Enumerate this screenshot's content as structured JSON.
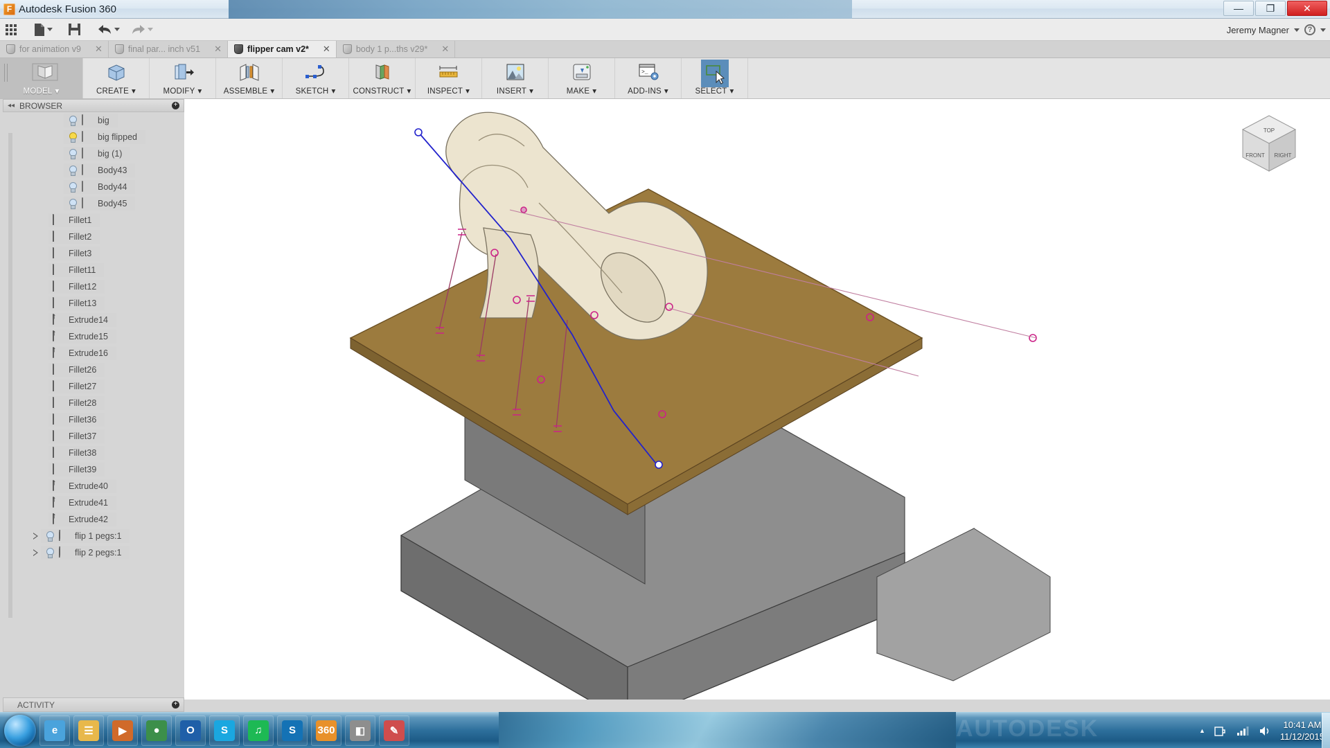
{
  "window": {
    "title": "Autodesk Fusion 360",
    "app_icon": "fusion-360-icon",
    "buttons": {
      "minimize": "—",
      "maximize": "❐",
      "close": "✕"
    }
  },
  "quick_access": {
    "items": [
      {
        "name": "app-grid-button",
        "icon": "grid-icon",
        "caret": false
      },
      {
        "name": "new-document-button",
        "icon": "file-icon",
        "caret": true
      },
      {
        "name": "save-button",
        "icon": "save-disk-icon",
        "caret": false
      },
      {
        "name": "undo-button",
        "icon": "undo-arrow-icon",
        "caret": true
      },
      {
        "name": "redo-button",
        "icon": "redo-arrow-icon",
        "caret": true
      }
    ],
    "user_name": "Jeremy Magner",
    "help_label": "?"
  },
  "document_tabs": [
    {
      "label": "for animation v9",
      "active": false,
      "close": "✕"
    },
    {
      "label": "final par... inch v51",
      "active": false,
      "close": "✕"
    },
    {
      "label": "flipper cam v2*",
      "active": true,
      "close": "✕"
    },
    {
      "label": "body 1 p...ths v29*",
      "active": false,
      "close": "✕"
    }
  ],
  "ribbon": {
    "workspace": {
      "label": "MODEL",
      "caret": "▾",
      "icon": "model-workspace-icon"
    },
    "items": [
      {
        "label": "CREATE",
        "caret": "▾",
        "icon": "create-cube-icon",
        "selected": false
      },
      {
        "label": "MODIFY",
        "caret": "▾",
        "icon": "modify-press-pull-icon",
        "selected": false
      },
      {
        "label": "ASSEMBLE",
        "caret": "▾",
        "icon": "assemble-joint-icon",
        "selected": false
      },
      {
        "label": "SKETCH",
        "caret": "▾",
        "icon": "sketch-spline-icon",
        "selected": false
      },
      {
        "label": "CONSTRUCT",
        "caret": "▾",
        "icon": "construct-plane-icon",
        "selected": false
      },
      {
        "label": "INSPECT",
        "caret": "▾",
        "icon": "inspect-ruler-icon",
        "selected": false
      },
      {
        "label": "INSERT",
        "caret": "▾",
        "icon": "insert-image-icon",
        "selected": false
      },
      {
        "label": "MAKE",
        "caret": "▾",
        "icon": "make-3d-print-icon",
        "selected": false
      },
      {
        "label": "ADD-INS",
        "caret": "▾",
        "icon": "add-ins-script-icon",
        "selected": false
      },
      {
        "label": "SELECT",
        "caret": "▾",
        "icon": "select-cursor-icon",
        "selected": true
      }
    ]
  },
  "browser": {
    "title": "BROWSER",
    "collapse_icon": "◂◂",
    "options_icon": "⊕",
    "nodes": [
      {
        "label": "big",
        "type": "body",
        "bulb": "off",
        "indent": 3,
        "expand": false
      },
      {
        "label": "big flipped",
        "type": "body",
        "bulb": "on",
        "indent": 3,
        "expand": false
      },
      {
        "label": "big (1)",
        "type": "body",
        "bulb": "off",
        "indent": 3,
        "expand": false
      },
      {
        "label": "Body43",
        "type": "body",
        "bulb": "off",
        "indent": 3,
        "expand": false
      },
      {
        "label": "Body44",
        "type": "body",
        "bulb": "off",
        "indent": 3,
        "expand": false
      },
      {
        "label": "Body45",
        "type": "body",
        "bulb": "off",
        "indent": 3,
        "expand": false
      },
      {
        "label": "Fillet1",
        "type": "fillet",
        "bulb": "none",
        "indent": 2,
        "expand": false
      },
      {
        "label": "Fillet2",
        "type": "fillet",
        "bulb": "none",
        "indent": 2,
        "expand": false
      },
      {
        "label": "Fillet3",
        "type": "fillet",
        "bulb": "none",
        "indent": 2,
        "expand": false
      },
      {
        "label": "Fillet11",
        "type": "fillet",
        "bulb": "none",
        "indent": 2,
        "expand": false
      },
      {
        "label": "Fillet12",
        "type": "fillet",
        "bulb": "none",
        "indent": 2,
        "expand": false
      },
      {
        "label": "Fillet13",
        "type": "fillet",
        "bulb": "none",
        "indent": 2,
        "expand": false
      },
      {
        "label": "Extrude14",
        "type": "extrude",
        "bulb": "none",
        "indent": 2,
        "expand": false
      },
      {
        "label": "Extrude15",
        "type": "extrude",
        "bulb": "none",
        "indent": 2,
        "expand": false
      },
      {
        "label": "Extrude16",
        "type": "extrude",
        "bulb": "none",
        "indent": 2,
        "expand": false
      },
      {
        "label": "Fillet26",
        "type": "fillet",
        "bulb": "none",
        "indent": 2,
        "expand": false
      },
      {
        "label": "Fillet27",
        "type": "fillet",
        "bulb": "none",
        "indent": 2,
        "expand": false
      },
      {
        "label": "Fillet28",
        "type": "fillet",
        "bulb": "none",
        "indent": 2,
        "expand": false
      },
      {
        "label": "Fillet36",
        "type": "fillet",
        "bulb": "none",
        "indent": 2,
        "expand": false
      },
      {
        "label": "Fillet37",
        "type": "fillet",
        "bulb": "none",
        "indent": 2,
        "expand": false
      },
      {
        "label": "Fillet38",
        "type": "fillet",
        "bulb": "none",
        "indent": 2,
        "expand": false
      },
      {
        "label": "Fillet39",
        "type": "fillet",
        "bulb": "none",
        "indent": 2,
        "expand": false
      },
      {
        "label": "Extrude40",
        "type": "extrude",
        "bulb": "none",
        "indent": 2,
        "expand": false
      },
      {
        "label": "Extrude41",
        "type": "extrude",
        "bulb": "none",
        "indent": 2,
        "expand": false
      },
      {
        "label": "Extrude42",
        "type": "extrude",
        "bulb": "none",
        "indent": 2,
        "expand": false
      },
      {
        "label": "flip 1 pegs:1",
        "type": "component",
        "bulb": "off",
        "indent": 1,
        "expand": true
      },
      {
        "label": "flip 2 pegs:1",
        "type": "component",
        "bulb": "off",
        "indent": 1,
        "expand": true
      }
    ]
  },
  "activity": {
    "title": "ACTIVITY",
    "options_icon": "⊕"
  },
  "canvas": {
    "viewcube": {
      "top": "TOP",
      "front": "FRONT",
      "right": "RIGHT"
    },
    "model_colors": {
      "plywood_top": "#9c7b3e",
      "metal_base": "#8e8e8e",
      "metal_base_dark": "#6e6e6e",
      "bone_part": "#ece4cf",
      "sketch_line": "#2222cc",
      "constraint_point": "#cc2288",
      "dimension_line": "#9b3a63"
    }
  },
  "navbar": {
    "group1": [
      {
        "name": "orbit-button",
        "icon": "orbit-icon",
        "caret": true
      },
      {
        "name": "look-at-button",
        "icon": "look-at-icon",
        "caret": false
      },
      {
        "name": "pan-button",
        "icon": "hand-pan-icon",
        "caret": false
      },
      {
        "name": "zoom-button",
        "icon": "zoom-icon",
        "caret": false
      },
      {
        "name": "fit-button",
        "icon": "fit-view-icon",
        "caret": false
      }
    ],
    "group2": [
      {
        "name": "display-settings-button",
        "icon": "monitor-icon",
        "caret": true
      },
      {
        "name": "grid-snap-button",
        "icon": "grid-snap-icon",
        "caret": true
      },
      {
        "name": "viewports-button",
        "icon": "viewports-icon",
        "caret": true
      }
    ]
  },
  "taskbar": {
    "start": "start-orb",
    "apps": [
      {
        "name": "internet-explorer-icon",
        "glyph": "e",
        "color": "#4aa3dc"
      },
      {
        "name": "file-explorer-icon",
        "glyph": "☰",
        "color": "#e8b84b"
      },
      {
        "name": "media-player-icon",
        "glyph": "▶",
        "color": "#d06a2a"
      },
      {
        "name": "google-chrome-icon",
        "glyph": "●",
        "color": "#3c8f4a"
      },
      {
        "name": "outlook-icon",
        "glyph": "O",
        "color": "#1f5fa8"
      },
      {
        "name": "skype-icon",
        "glyph": "S",
        "color": "#1aa7e0"
      },
      {
        "name": "spotify-icon",
        "glyph": "♫",
        "color": "#1db954"
      },
      {
        "name": "skype-business-icon",
        "glyph": "S",
        "color": "#1472b5"
      },
      {
        "name": "fusion-360-icon",
        "glyph": "360",
        "color": "#e8912a"
      },
      {
        "name": "cad-viewer-icon",
        "glyph": "◧",
        "color": "#8e8e8e"
      },
      {
        "name": "paint-icon",
        "glyph": "✎",
        "color": "#cf4d4d"
      }
    ],
    "tray": {
      "show_hidden_icon": "▲",
      "network_icon": "network-signal-icon",
      "battery_icon": "battery-icon",
      "volume_icon": "volume-icon",
      "time": "10:41 AM",
      "date": "11/12/2015",
      "watermark": "AUTODESK"
    }
  }
}
